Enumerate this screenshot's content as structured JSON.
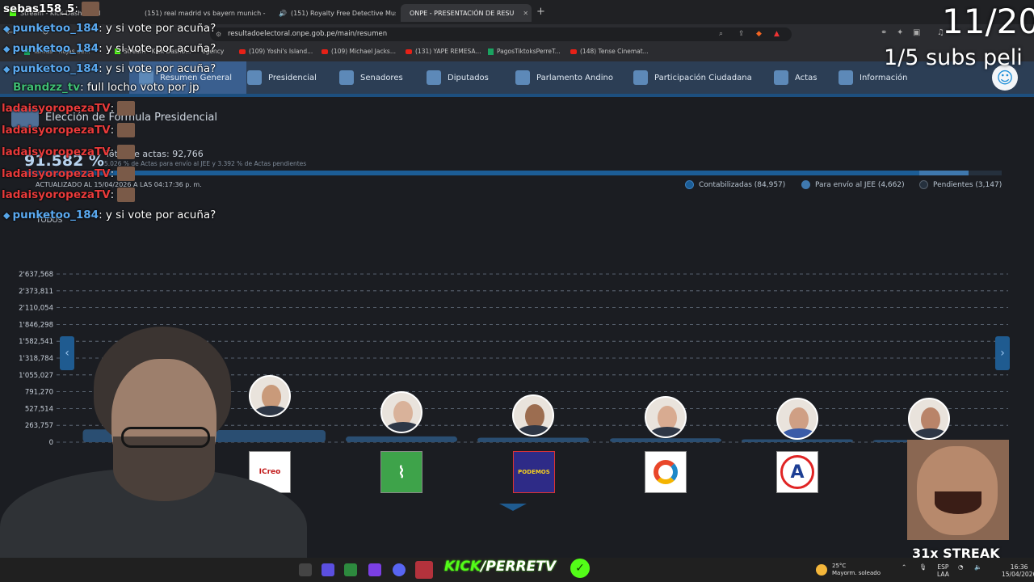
{
  "browser": {
    "tabs": [
      {
        "label": "Stream - Kick Dashboard",
        "kind": "kick"
      },
      {
        "label": "(151) real madrid vs bayern munich -",
        "kind": "youtube"
      },
      {
        "label": "(151) Royalty Free Detective Musi",
        "kind": "youtube-audio"
      },
      {
        "label": "ONPE - PRESENTACIÓN DE RESU",
        "kind": "active"
      }
    ],
    "new_tab": "+",
    "url": "resultadoelectoral.onpe.gob.pe/main/resumen",
    "bookmarks": [
      {
        "label": "Tarifas - hojas de...",
        "kind": "sheets"
      },
      {
        "label": "Stream - Kick Dashb...",
        "kind": "kick"
      },
      {
        "label": "egency",
        "kind": "plain"
      },
      {
        "label": "(109) Yoshi's Island...",
        "kind": "youtube"
      },
      {
        "label": "(109) Michael Jacks...",
        "kind": "youtube"
      },
      {
        "label": "(131) YAPE REMESA...",
        "kind": "youtube"
      },
      {
        "label": "PagosTiktoksPerreT...",
        "kind": "sheets"
      },
      {
        "label": "(148) Tense Cinemat...",
        "kind": "youtube"
      }
    ]
  },
  "site_nav": {
    "items": [
      {
        "label": "Resumen General",
        "icon": "summary-icon",
        "active": true
      },
      {
        "label": "Presidencial",
        "icon": "president-icon"
      },
      {
        "label": "Senadores",
        "icon": "senate-icon"
      },
      {
        "label": "Diputados",
        "icon": "congress-icon"
      },
      {
        "label": "Parlamento Andino",
        "icon": "andean-parliament-icon"
      },
      {
        "label": "Participación Ciudadana",
        "icon": "participation-icon"
      },
      {
        "label": "Actas",
        "icon": "records-icon"
      },
      {
        "label": "Información",
        "icon": "info-icon"
      }
    ]
  },
  "summary": {
    "title": "Elección de Fórmula Presidencial",
    "percent": "91.582 %",
    "actas_total": "Total de actas: 92,766",
    "actas_note": "5.026 % de Actas para envío al JEE y 3.392 % de Actas pendientes",
    "updated": "ACTUALIZADO AL 15/04/2026 A LAS 04:17:36 p. m.",
    "progress": {
      "counted_pct": 91.582,
      "jee_pct": 5.026,
      "pending_pct": 3.392
    },
    "legend": [
      {
        "label": "Contabilizadas (84,957)",
        "color": "#1c5d96"
      },
      {
        "label": "Para envío al JEE (4,662)",
        "color": "#3f78ae"
      },
      {
        "label": "Pendientes (3,147)",
        "color": "#25303d"
      }
    ],
    "filter": "TODOS"
  },
  "chart_data": {
    "type": "bar",
    "yticks": [
      "2'637,568",
      "2'373,811",
      "2'110,054",
      "1'846,298",
      "1'582,541",
      "1'318,784",
      "1'055,027",
      "791,270",
      "527,514",
      "263,757",
      "0"
    ],
    "ylim": [
      0,
      2637568
    ],
    "values": [
      200000,
      190000,
      90000,
      70000,
      60000,
      45000,
      35000
    ],
    "party_labels": [
      "",
      "ICreo",
      "",
      "PODEMOS",
      "",
      "A",
      ""
    ],
    "bar_color": "#2a4e72",
    "grid": true
  },
  "overlay": {
    "chat": [
      {
        "user": "sebas158_5",
        "color": "#ffffff",
        "msg": ":",
        "badge": true
      },
      {
        "user": "punketoo_184",
        "color": "#5aa9f0",
        "msg": ": y si vote por acuña?"
      },
      {
        "user": "punketoo_184",
        "color": "#5aa9f0",
        "msg": ": y si vote por acuña?"
      },
      {
        "user": "punketoo_184",
        "color": "#5aa9f0",
        "msg": ": y si vote por acuña?"
      },
      {
        "user": "Brandzz_tv",
        "color": "#3fbf74",
        "msg": ": full locho voto por jp"
      },
      {
        "user": "ladaisyoropezaTV",
        "color": "#e83a3a",
        "msg": ":",
        "badge": true
      },
      {
        "user": "ladaisyoropezaTV",
        "color": "#e83a3a",
        "msg": ":",
        "badge": true
      },
      {
        "user": "ladaisyoropezaTV",
        "color": "#e83a3a",
        "msg": ":",
        "badge": true
      },
      {
        "user": "ladaisyoropezaTV",
        "color": "#e83a3a",
        "msg": ":",
        "badge": true
      },
      {
        "user": "ladaisyoropezaTV",
        "color": "#e83a3a",
        "msg": ":",
        "badge": true
      },
      {
        "user": "punketoo_184",
        "color": "#5aa9f0",
        "msg": ": y si vote por acuña?"
      }
    ],
    "counter": "11/20",
    "subs_goal": "1/5 subs peli",
    "streak": "31x STREAK",
    "brand_kick": "KICK",
    "brand_rest": "/PERRETV"
  },
  "taskbar": {
    "weather_temp": "25°C",
    "weather_desc": "Mayorm. soleado",
    "lang": "ESP",
    "lang2": "LAA",
    "time": "16:36",
    "date": "15/04/2026"
  }
}
